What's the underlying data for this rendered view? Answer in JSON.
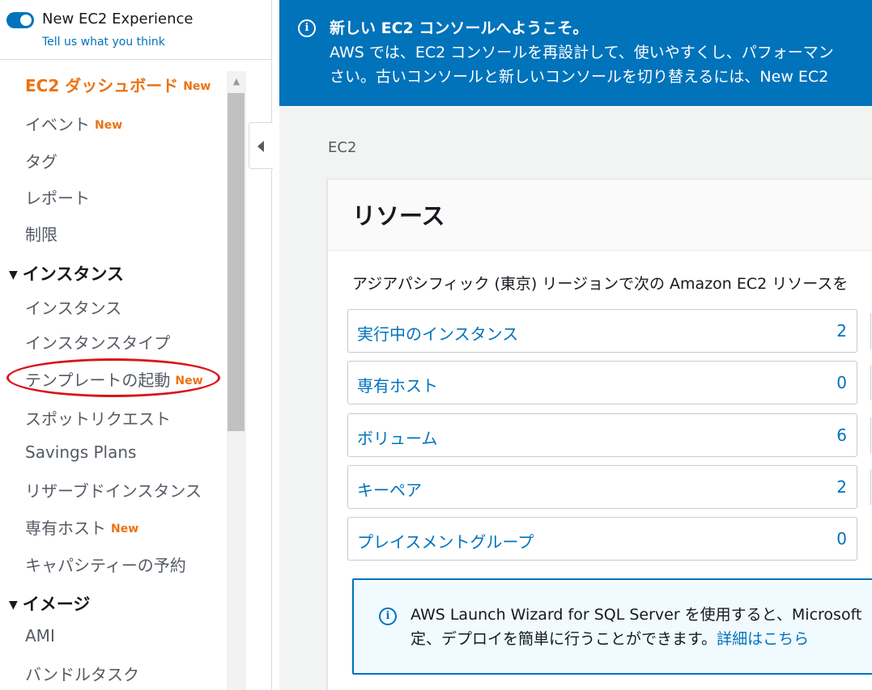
{
  "sidebar": {
    "toggle_label": "New EC2 Experience",
    "feedback_link": "Tell us what you think",
    "new_badge": "New",
    "dashboard": "EC2 ダッシュボード",
    "events": "イベント",
    "tags": "タグ",
    "reports": "レポート",
    "limits": "制限",
    "instances_section": "インスタンス",
    "instances": "インスタンス",
    "instance_types": "インスタンスタイプ",
    "launch_templates": "テンプレートの起動",
    "spot_requests": "スポットリクエスト",
    "savings_plans": "Savings Plans",
    "reserved_instances": "リザーブドインスタンス",
    "dedicated_hosts": "専有ホスト",
    "capacity_reservations": "キャパシティーの予約",
    "images_section": "イメージ",
    "ami": "AMI",
    "bundle_tasks": "バンドルタスク"
  },
  "flash": {
    "title": "新しい EC2 コンソールへようこそ。",
    "body_line1": "AWS では、EC2 コンソールを再設計して、使いやすくし、パフォーマン",
    "body_line2": "さい。古いコンソールと新しいコンソールを切り替えるには、New EC2"
  },
  "breadcrumb": "EC2",
  "resources": {
    "title": "リソース",
    "description": "アジアパシフィック (東京) リージョンで次の Amazon EC2 リソースを",
    "items": [
      {
        "name": "実行中のインスタンス",
        "count": "2"
      },
      {
        "name": "専有ホスト",
        "count": "0"
      },
      {
        "name": "ボリューム",
        "count": "6"
      },
      {
        "name": "キーペア",
        "count": "2"
      },
      {
        "name": "プレイスメントグループ",
        "count": "0"
      }
    ]
  },
  "info": {
    "line1": "AWS Launch Wizard for SQL Server を使用すると、Microsoft",
    "line2_text": "定、デプロイを簡単に行うことができます。",
    "link": "詳細はこちら"
  },
  "colors": {
    "accent_blue": "#0073bb",
    "active_orange": "#ec7211",
    "annotation_red": "#d9151b"
  }
}
